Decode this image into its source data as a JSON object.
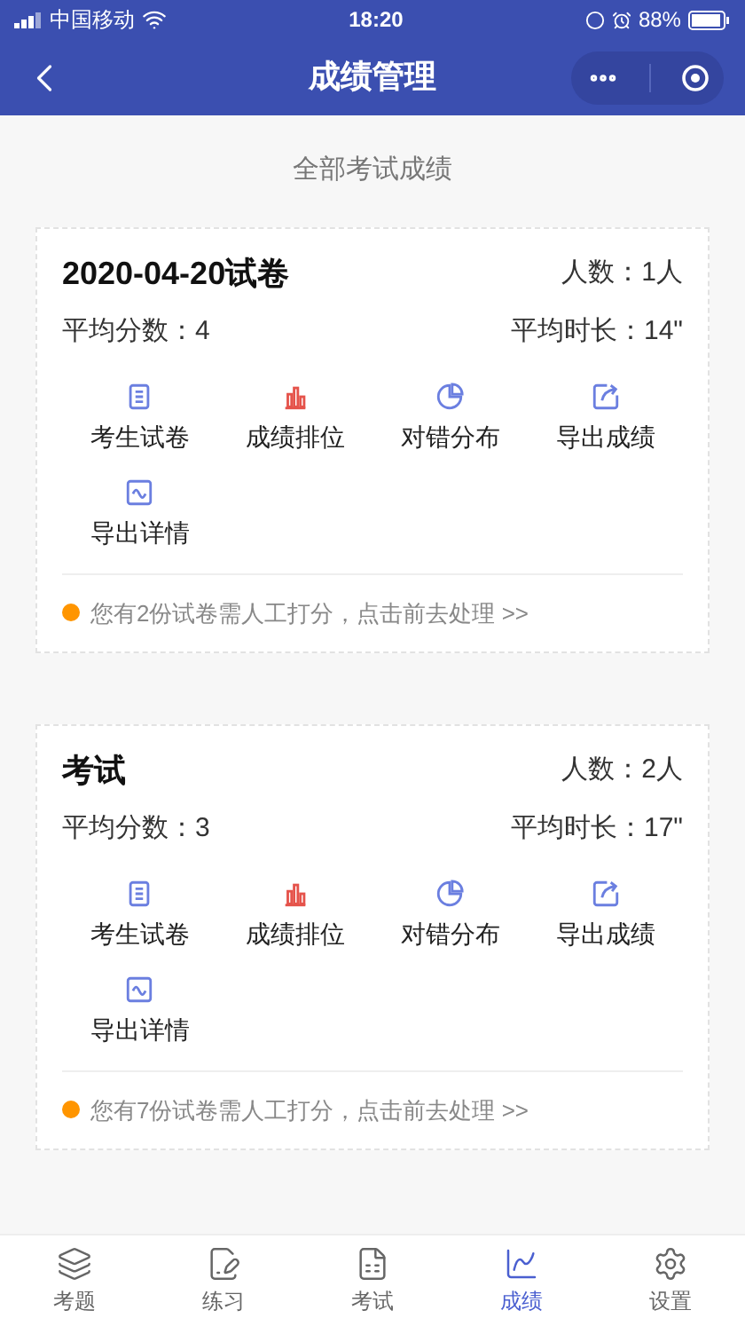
{
  "status_bar": {
    "carrier": "中国移动",
    "time": "18:20",
    "battery": "88%"
  },
  "nav": {
    "title": "成绩管理"
  },
  "section_title": "全部考试成绩",
  "exams": [
    {
      "title": "2020-04-20试卷",
      "count_label": "人数：1人",
      "avg_score": "平均分数：4",
      "avg_time": "平均时长：14\"",
      "actions": [
        {
          "kind": "papers",
          "label": "考生试卷"
        },
        {
          "kind": "ranking",
          "label": "成绩排位"
        },
        {
          "kind": "distribution",
          "label": "对错分布"
        },
        {
          "kind": "export",
          "label": "导出成绩"
        },
        {
          "kind": "details",
          "label": "导出详情"
        }
      ],
      "notice": "您有2份试卷需人工打分，点击前去处理 >>"
    },
    {
      "title": "考试",
      "count_label": "人数：2人",
      "avg_score": "平均分数：3",
      "avg_time": "平均时长：17\"",
      "actions": [
        {
          "kind": "papers",
          "label": "考生试卷"
        },
        {
          "kind": "ranking",
          "label": "成绩排位"
        },
        {
          "kind": "distribution",
          "label": "对错分布"
        },
        {
          "kind": "export",
          "label": "导出成绩"
        },
        {
          "kind": "details",
          "label": "导出详情"
        }
      ],
      "notice": "您有7份试卷需人工打分，点击前去处理 >>"
    }
  ],
  "tab_bar": [
    {
      "kind": "layers",
      "label": "考题",
      "selected": false
    },
    {
      "kind": "edit",
      "label": "练习",
      "selected": false
    },
    {
      "kind": "exam",
      "label": "考试",
      "selected": false
    },
    {
      "kind": "chart",
      "label": "成绩",
      "selected": true
    },
    {
      "kind": "settings",
      "label": "设置",
      "selected": false
    }
  ]
}
